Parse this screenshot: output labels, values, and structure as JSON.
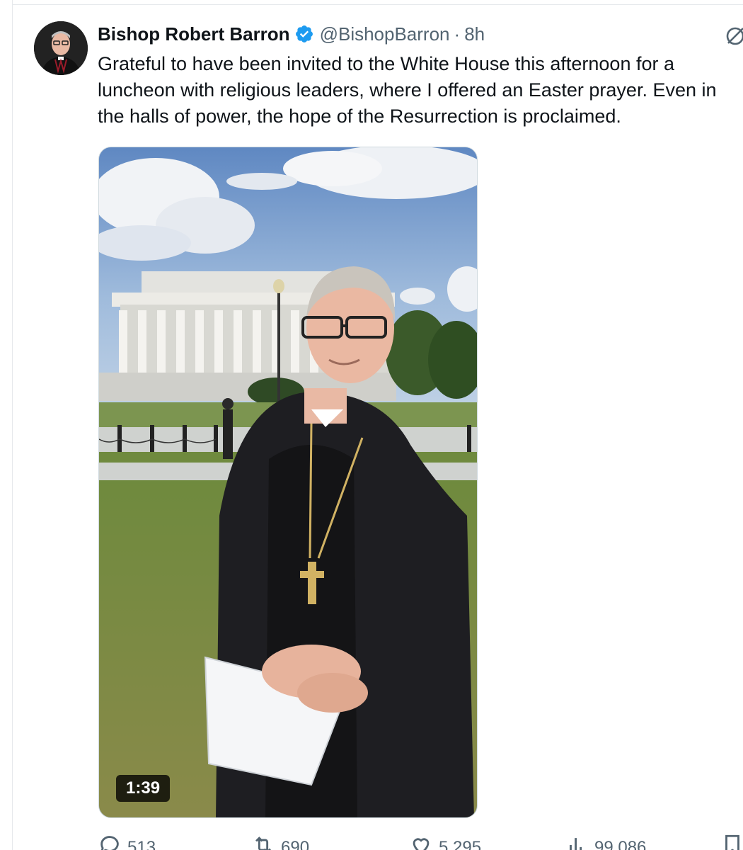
{
  "tweet": {
    "display_name": "Bishop Robert Barron",
    "handle": "@BishopBarron",
    "separator": "·",
    "time": "8h",
    "text_lines": [
      "Grateful to have been invited to the White House this afternoon for a",
      "luncheon with religious leaders, where I offered an Easter prayer. Even in",
      "the halls of power, the hope of the Resurrection is proclaimed."
    ],
    "video_duration": "1:39"
  },
  "actions": {
    "replies": "513",
    "reposts": "690",
    "likes": "5,295",
    "views": "99,086"
  },
  "icons": {
    "verified": "verified-badge-icon",
    "grok": "grok-icon",
    "reply": "reply-icon",
    "repost": "repost-icon",
    "like": "heart-icon",
    "views": "views-icon",
    "bookmark": "bookmark-icon"
  },
  "colors": {
    "verified": "#1d9bf0",
    "text_primary": "#0f1419",
    "text_secondary": "#536471"
  }
}
